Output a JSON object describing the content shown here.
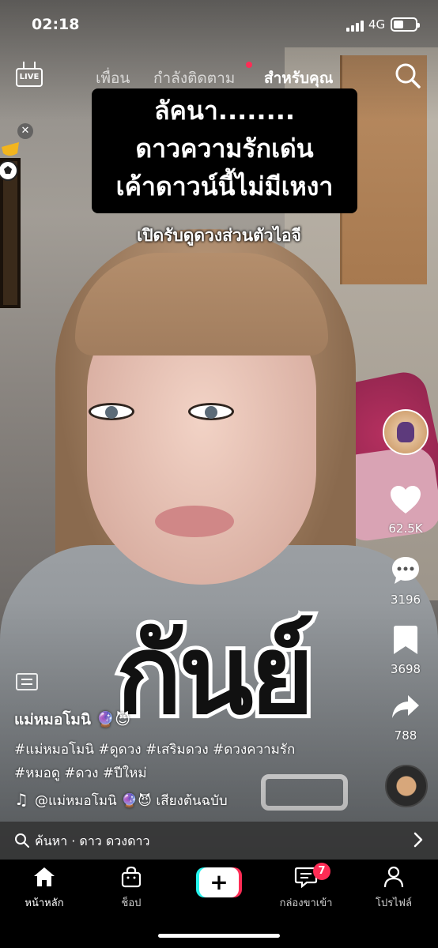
{
  "status_bar": {
    "time": "02:18",
    "network": "4G"
  },
  "top_nav": {
    "live_label": "LIVE",
    "tabs": [
      {
        "label": "เพื่อน",
        "active": false
      },
      {
        "label": "กำลังติดตาม",
        "active": false,
        "has_dot": true
      },
      {
        "label": "สำหรับคุณ",
        "active": true
      }
    ]
  },
  "video": {
    "caption_lines": [
      "ลัคนา........",
      "ดาวความรักเด่น",
      "เค้าดาวน์นี้ไม่มีเหงา"
    ],
    "sub_caption": "เปิดรับดูดวงส่วนตัวไอจี",
    "overlay_text": "กันย์"
  },
  "actions": {
    "likes": "62.5K",
    "comments": "3196",
    "saves": "3698",
    "shares": "788"
  },
  "post": {
    "author": "แม่หมอโมนิ 🔮😈",
    "hashtags_line1": "#แม่หมอโมนิ #ดูดวง #เสริมดวง #ดวงความรัก",
    "hashtags_line2": "#หมอดู #ดวง #ปีใหม่",
    "sound": "@แม่หมอโมนิ 🔮😈 เสียงต้นฉบับ"
  },
  "search_suggestion": {
    "text": "ค้นหา · ดาว ดวงดาว"
  },
  "bottom_nav": {
    "home": "หน้าหลัก",
    "shop": "ช็อป",
    "inbox": "กล่องขาเข้า",
    "inbox_badge": "7",
    "profile": "โปรไฟล์"
  },
  "colors": {
    "accent_red": "#fe2c55",
    "accent_cyan": "#25f4ee"
  }
}
